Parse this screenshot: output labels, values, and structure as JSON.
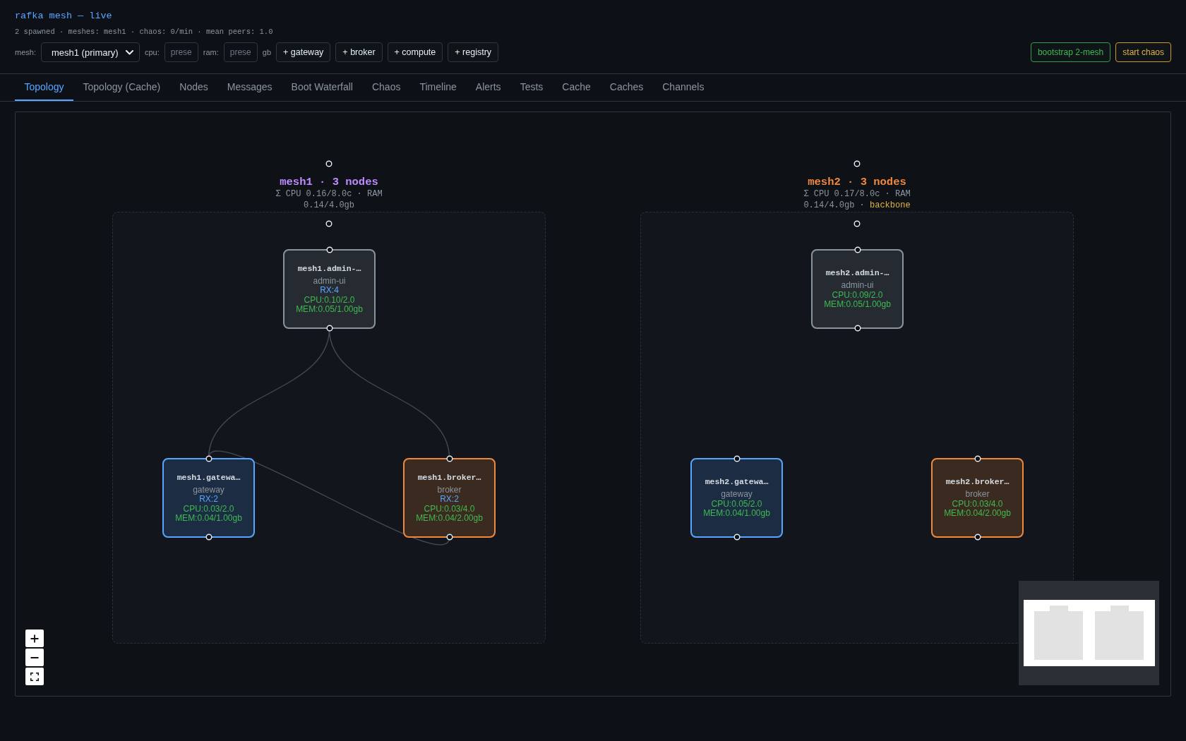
{
  "header": {
    "title": "rafka mesh — live",
    "summary": "2 spawned · meshes: mesh1 · chaos: 0/min · mean peers: 1.0"
  },
  "toolbar": {
    "mesh_label": "mesh:",
    "mesh_select": "mesh1 (primary)",
    "cpu_label": "cpu:",
    "cpu_field": {
      "placeholder": "prese"
    },
    "ram_label": "ram:",
    "ram_field": {
      "placeholder": "prese"
    },
    "ram_unit": "gb",
    "add_buttons": [
      "+ gateway",
      "+ broker",
      "+ compute",
      "+ registry"
    ],
    "actions": [
      {
        "label": "bootstrap 2-mesh",
        "kind": "bootstrap"
      },
      {
        "label": "start chaos",
        "kind": "chaos"
      }
    ]
  },
  "tabs": [
    {
      "label": "Topology",
      "selected": true
    },
    {
      "label": "Topology (Cache)",
      "selected": false
    },
    {
      "label": "Nodes",
      "selected": false
    },
    {
      "label": "Messages",
      "selected": false
    },
    {
      "label": "Boot Waterfall",
      "selected": false
    },
    {
      "label": "Chaos",
      "selected": false
    },
    {
      "label": "Timeline",
      "selected": false
    },
    {
      "label": "Alerts",
      "selected": false
    },
    {
      "label": "Tests",
      "selected": false
    },
    {
      "label": "Cache",
      "selected": false
    },
    {
      "label": "Caches",
      "selected": false
    },
    {
      "label": "Channels",
      "selected": false
    }
  ],
  "topology": {
    "meshes": [
      {
        "title": "mesh1 · 3 nodes",
        "color": "#bc8cff",
        "resources": "Σ CPU 0.16/8.0c · RAM 0.14/4.0gb",
        "nodes": [
          {
            "kind": "admin",
            "name": "mesh1.admin-…",
            "role": "admin-ui",
            "rx": "RX:4",
            "cpu": "CPU:0.10/2.0",
            "mem": "MEM:0.05/1.00gb"
          },
          {
            "kind": "gateway",
            "name": "mesh1.gatewa…",
            "role": "gateway",
            "rx": "RX:2",
            "cpu": "CPU:0.03/2.0",
            "mem": "MEM:0.04/1.00gb",
            "uplink": true,
            "peer_link": false
          },
          {
            "kind": "broker",
            "name": "mesh1.broker…",
            "role": "broker",
            "rx": "RX:2",
            "cpu": "CPU:0.03/4.0",
            "mem": "MEM:0.04/2.00gb",
            "uplink": true,
            "peer_link": true
          }
        ]
      },
      {
        "title": "mesh2 · 3 nodes",
        "color": "#f0883e",
        "resources": "Σ CPU 0.17/8.0c · RAM 0.14/4.0gb ·",
        "tag": "backbone",
        "nodes": [
          {
            "kind": "admin",
            "name": "mesh2.admin-…",
            "role": "admin-ui",
            "cpu": "CPU:0.09/2.0",
            "mem": "MEM:0.05/1.00gb"
          },
          {
            "kind": "gateway",
            "name": "mesh2.gatewa…",
            "role": "gateway",
            "cpu": "CPU:0.05/2.0",
            "mem": "MEM:0.04/1.00gb",
            "uplink": false,
            "peer_link": false
          },
          {
            "kind": "broker",
            "name": "mesh2.broker…",
            "role": "broker",
            "cpu": "CPU:0.03/4.0",
            "mem": "MEM:0.04/2.00gb",
            "uplink": false,
            "peer_link": false
          }
        ]
      }
    ]
  }
}
